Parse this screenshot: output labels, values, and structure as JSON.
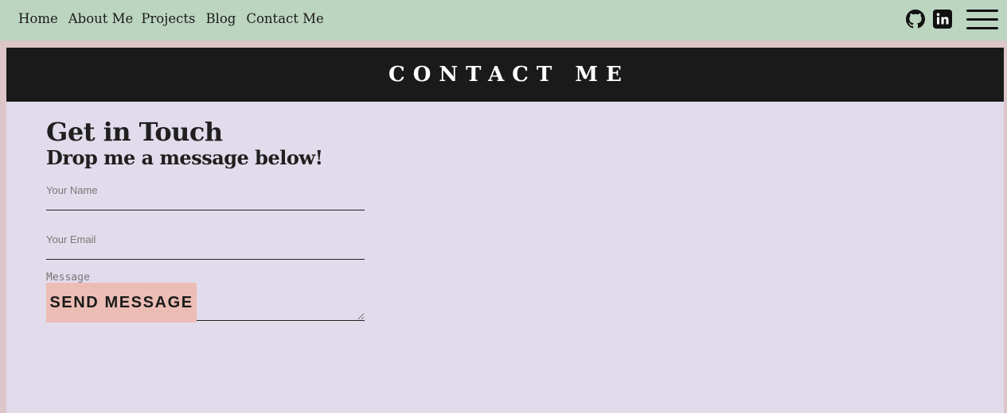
{
  "nav": {
    "links": [
      "Home",
      "About Me",
      "Projects",
      "Blog",
      "Contact Me"
    ],
    "icons": [
      "github-icon",
      "linkedin-icon",
      "hamburger-menu-icon"
    ]
  },
  "banner": {
    "title": "CONTACT ME"
  },
  "form": {
    "heading": "Get in Touch",
    "subheading": "Drop me a message below!",
    "name_placeholder": "Your Name",
    "email_placeholder": "Your Email",
    "message_placeholder": "Message",
    "submit_label": "SEND MESSAGE"
  },
  "colors": {
    "nav_bg": "#bcd5c1",
    "page_bg": "#dcc6c8",
    "panel_bg": "#e1dbeb",
    "banner_bg": "#1a1a1a",
    "button_bg": "#ecbdb5"
  }
}
